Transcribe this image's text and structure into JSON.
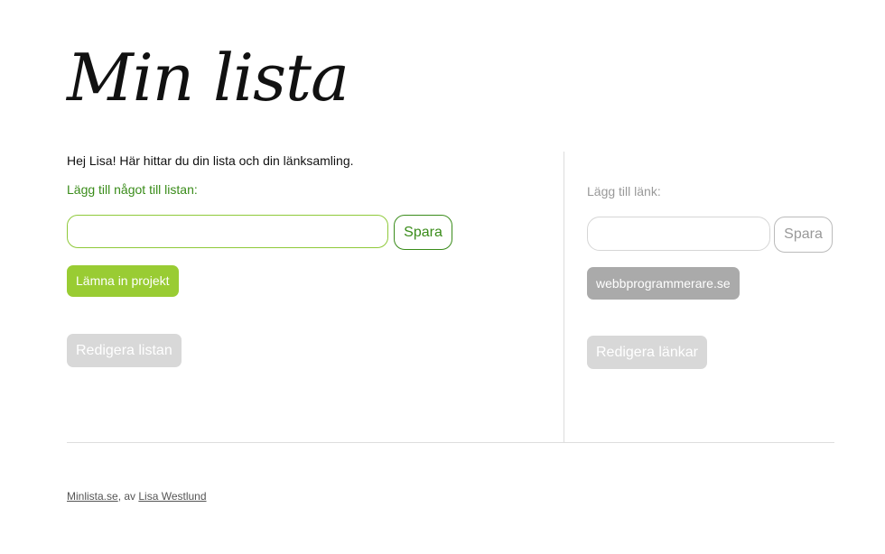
{
  "header": {
    "title": "Min lista"
  },
  "list_panel": {
    "greeting": "Hej Lisa! Här hittar du din lista och din länksamling.",
    "add_label": "Lägg till något till listan:",
    "input_value": "",
    "save_label": "Spara",
    "items": [
      "Lämna in projekt"
    ],
    "edit_label": "Redigera listan"
  },
  "link_panel": {
    "add_label": "Lägg till länk:",
    "input_value": "",
    "save_label": "Spara",
    "links": [
      "webbprogrammerare.se"
    ],
    "edit_label": "Redigera länkar"
  },
  "footer": {
    "site_link": "Minlista.se",
    "separator": ", av ",
    "author_link": "Lisa Westlund"
  },
  "colors": {
    "accent_green": "#99cc33",
    "label_green": "#3a8c1a",
    "muted_gray": "#aaaaaa",
    "disabled_gray": "#d8d8d8"
  }
}
